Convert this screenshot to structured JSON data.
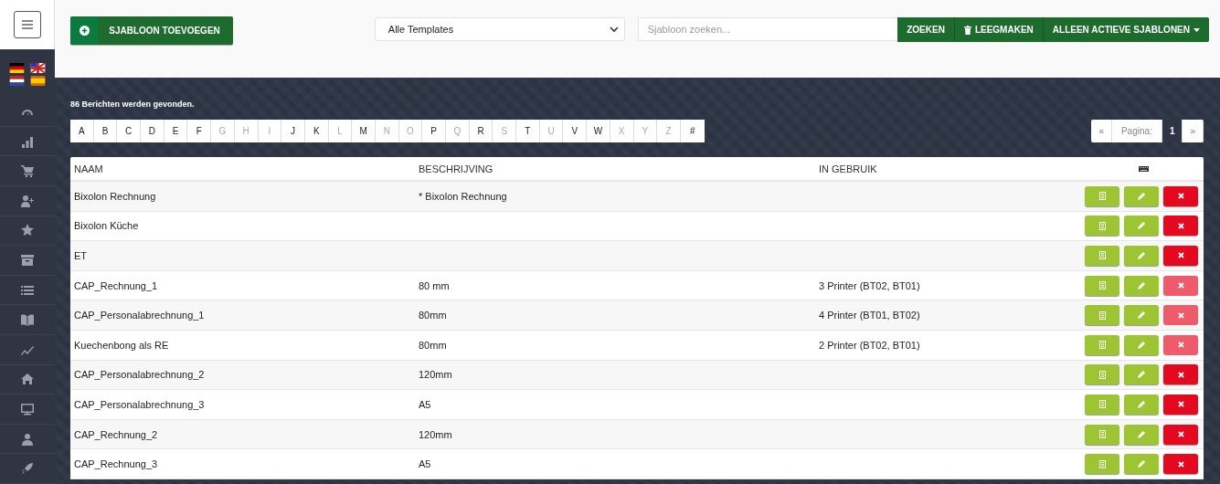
{
  "header": {
    "add_button": "SJABLOON TOEVOEGEN",
    "template_select": "Alle Templates",
    "search": {
      "placeholder": "Sjabloon zoeken..."
    },
    "search_button": "ZOEKEN",
    "clear_button": "LEEGMAKEN",
    "filter_button": "ALLEEN ACTIEVE SJABLONEN"
  },
  "result_count": "86 Berichten werden gevonden.",
  "letters": [
    {
      "label": "A",
      "disabled": false
    },
    {
      "label": "B",
      "disabled": false
    },
    {
      "label": "C",
      "disabled": false
    },
    {
      "label": "D",
      "disabled": false
    },
    {
      "label": "E",
      "disabled": false
    },
    {
      "label": "F",
      "disabled": false
    },
    {
      "label": "G",
      "disabled": true
    },
    {
      "label": "H",
      "disabled": true
    },
    {
      "label": "I",
      "disabled": true
    },
    {
      "label": "J",
      "disabled": false
    },
    {
      "label": "K",
      "disabled": false
    },
    {
      "label": "L",
      "disabled": true
    },
    {
      "label": "M",
      "disabled": false
    },
    {
      "label": "N",
      "disabled": true
    },
    {
      "label": "O",
      "disabled": true
    },
    {
      "label": "P",
      "disabled": false
    },
    {
      "label": "Q",
      "disabled": true
    },
    {
      "label": "R",
      "disabled": false
    },
    {
      "label": "S",
      "disabled": true
    },
    {
      "label": "T",
      "disabled": false
    },
    {
      "label": "U",
      "disabled": true
    },
    {
      "label": "V",
      "disabled": false
    },
    {
      "label": "W",
      "disabled": false
    },
    {
      "label": "X",
      "disabled": true
    },
    {
      "label": "Y",
      "disabled": true
    },
    {
      "label": "Z",
      "disabled": true
    },
    {
      "label": "#",
      "disabled": false
    }
  ],
  "pagination": {
    "prev": "«",
    "page_label": "Pagina:",
    "page": "1",
    "next": "»"
  },
  "table": {
    "columns": [
      "NAAM",
      "BESCHRIJVING",
      "IN GEBRUIK"
    ],
    "rows": [
      {
        "name": "Bixolon Rechnung",
        "description": "* Bixolon Rechnung",
        "delete_disabled": false
      },
      {
        "name": "Bixolon Küche",
        "delete_disabled": false
      },
      {
        "name": "ET",
        "delete_disabled": false
      },
      {
        "name": "CAP_Rechnung_1",
        "description": "80 mm",
        "in_use": "3 Printer (BT02, BT01)",
        "delete_disabled": true
      },
      {
        "name": "CAP_Personalabrechnung_1",
        "description": "80mm",
        "in_use": "4 Printer (BT01, BT02)",
        "delete_disabled": true
      },
      {
        "name": "Kuechenbong als RE",
        "description": "80mm",
        "in_use": "2 Printer (BT02, BT01)",
        "delete_disabled": true
      },
      {
        "name": "CAP_Personalabrechnung_2",
        "description": "120mm",
        "delete_disabled": false
      },
      {
        "name": "CAP_Personalabrechnung_3",
        "description": "A5",
        "delete_disabled": false
      },
      {
        "name": "CAP_Rechnung_2",
        "description": "120mm",
        "delete_disabled": false
      },
      {
        "name": "CAP_Rechnung_3",
        "description": "A5",
        "delete_disabled": false
      }
    ]
  }
}
